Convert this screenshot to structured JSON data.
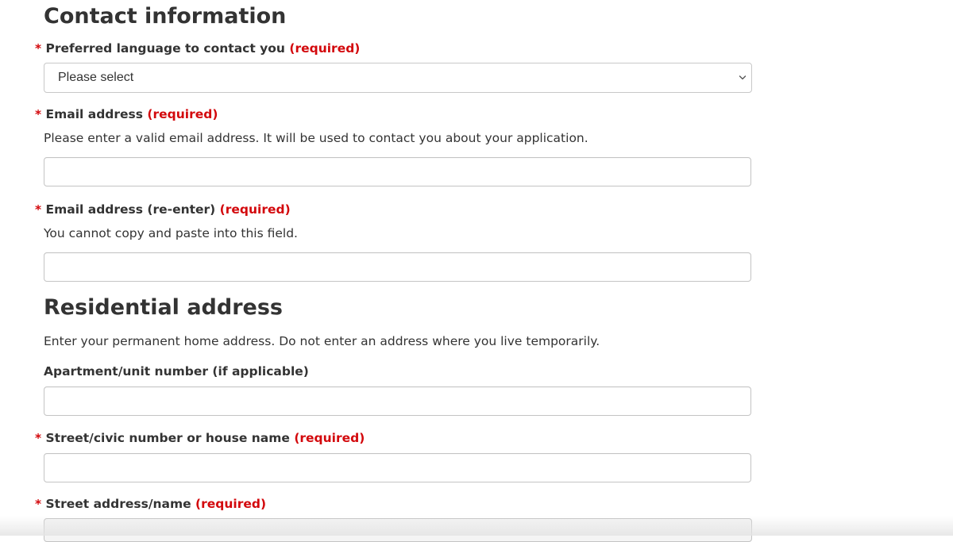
{
  "contact": {
    "heading": "Contact information",
    "required_marker": "*",
    "required_text": "(required)",
    "language": {
      "label": "Preferred language to contact you",
      "selected": "Please select"
    },
    "email": {
      "label": "Email address",
      "hint": "Please enter a valid email address. It will be used to contact you about your application.",
      "value": ""
    },
    "email_reenter": {
      "label": "Email address (re-enter)",
      "hint": "You cannot copy and paste into this field.",
      "value": ""
    }
  },
  "residential": {
    "heading": "Residential address",
    "intro": "Enter your permanent home address. Do not enter an address where you live temporarily.",
    "apartment": {
      "label": "Apartment/unit number (if applicable)",
      "value": ""
    },
    "street_number": {
      "label": "Street/civic number or house name",
      "value": ""
    },
    "street_name": {
      "label": "Street address/name",
      "value": ""
    }
  },
  "colors": {
    "required": "#d3080c",
    "text": "#333333",
    "border": "#c4c4c4"
  },
  "icons": {
    "select_chevron": "chevron-down-icon"
  }
}
